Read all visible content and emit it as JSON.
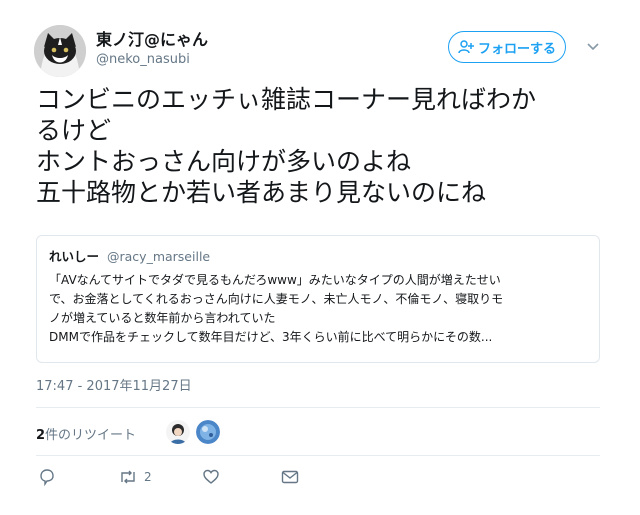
{
  "author": {
    "display_name": "東ノ汀@にゃん",
    "username": "@neko_nasubi",
    "avatar_icon": "cat-avatar"
  },
  "follow_button": {
    "label": "フォローする",
    "icon": "add-user-icon"
  },
  "menu_caret_icon": "chevron-down-icon",
  "tweet": {
    "lines": [
      "コンビニのエッチぃ雑誌コーナー見ればわか",
      "るけど",
      "ホントおっさん向けが多いのよね",
      "五十路物とか若い者あまり見ないのにね"
    ]
  },
  "quoted_tweet": {
    "display_name": "れいしー",
    "username": "@racy_marseille",
    "lines": [
      "「AVなんてサイトでタダで見るもんだろwww」みたいなタイプの人間が増えたせい",
      "で、お金落としてくれるおっさん向けに人妻モノ、未亡人モノ、不倫モノ、寝取りモ",
      "ノが増えていると数年前から言われていた",
      "DMMで作品をチェックして数年目だけど、3年くらい前に比べて明らかにその数..."
    ]
  },
  "timestamp": "17:47 - 2017年11月27日",
  "stats": {
    "retweet_count": "2",
    "retweet_label": "件のリツイート"
  },
  "actions": {
    "reply_icon": "reply-icon",
    "retweet_icon": "retweet-icon",
    "retweet_count": "2",
    "like_icon": "heart-icon",
    "dm_icon": "envelope-icon"
  },
  "colors": {
    "accent": "#1da1f2",
    "secondary_text": "#657786",
    "border": "#e1e8ed"
  }
}
